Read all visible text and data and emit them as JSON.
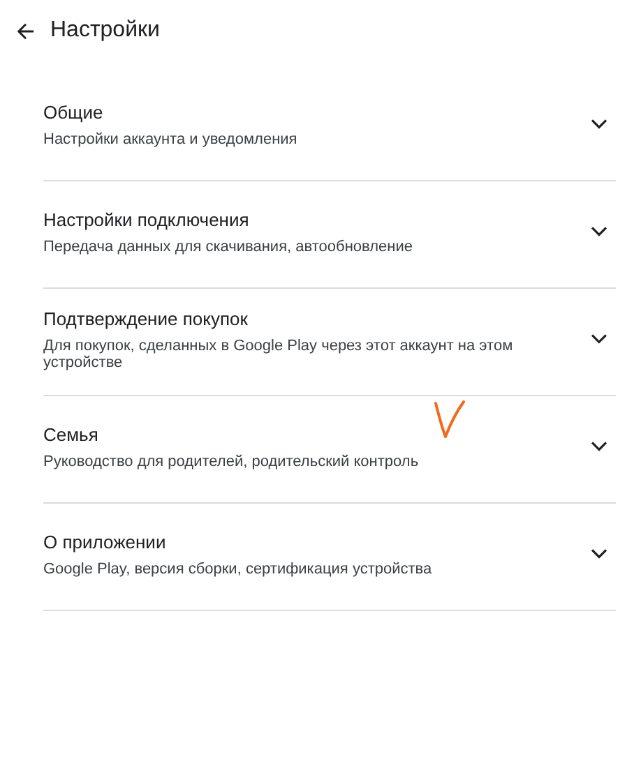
{
  "header": {
    "title": "Настройки"
  },
  "sections": [
    {
      "title": "Общие",
      "subtitle": "Настройки аккаунта и уведомления"
    },
    {
      "title": "Настройки подключения",
      "subtitle": "Передача данных для скачивания, автообновление"
    },
    {
      "title": "Подтверждение покупок",
      "subtitle": "Для покупок, сделанных в Google Play через этот аккаунт на этом устройстве"
    },
    {
      "title": "Семья",
      "subtitle": "Руководство для родителей, родительский контроль"
    },
    {
      "title": "О приложении",
      "subtitle": "Google Play, версия сборки, сертификация устройства"
    }
  ]
}
